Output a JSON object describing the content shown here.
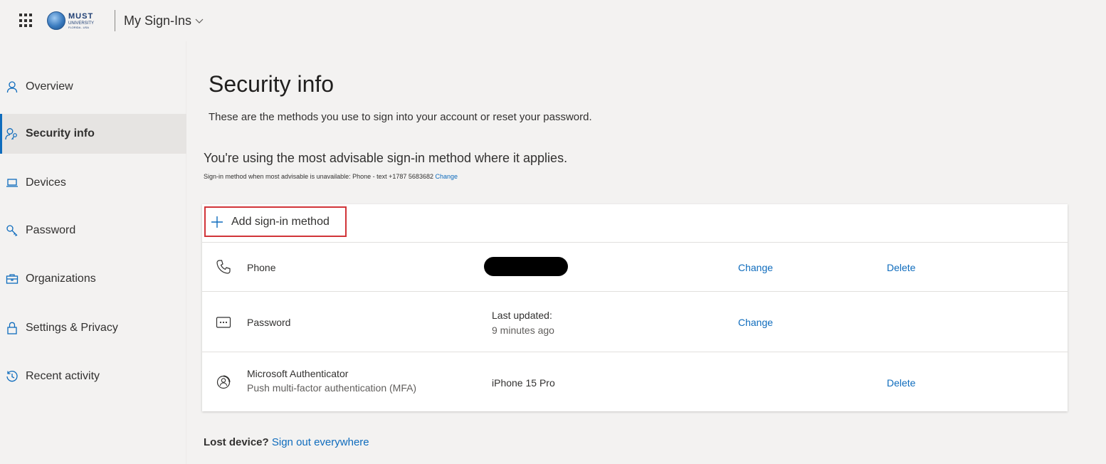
{
  "header": {
    "logo": {
      "line1": "MUST",
      "line2": "UNIVERSITY",
      "line3": "FLORIDA - USA"
    },
    "app_title": "My Sign-Ins"
  },
  "sidebar": {
    "items": [
      {
        "label": "Overview",
        "icon": "person-icon"
      },
      {
        "label": "Security info",
        "icon": "person-key-icon",
        "active": true
      },
      {
        "label": "Devices",
        "icon": "laptop-icon"
      },
      {
        "label": "Password",
        "icon": "key-icon"
      },
      {
        "label": "Organizations",
        "icon": "briefcase-icon"
      },
      {
        "label": "Settings & Privacy",
        "icon": "lock-icon"
      },
      {
        "label": "Recent activity",
        "icon": "history-icon"
      }
    ]
  },
  "main": {
    "title": "Security info",
    "subtitle": "These are the methods you use to sign into your account or reset your password.",
    "advisable": "You're using the most advisable sign-in method where it applies.",
    "fallback_text": "Sign-in method when most advisable is unavailable: Phone - text +1787 5683682",
    "fallback_link": "Change",
    "add_method_label": "Add sign-in method",
    "methods": [
      {
        "name": "Phone",
        "icon": "phone-icon",
        "detail": "",
        "redacted": true,
        "change": "Change",
        "delete": "Delete"
      },
      {
        "name": "Password",
        "icon": "password-dots-icon",
        "detail_line1": "Last updated:",
        "detail_line2": "9 minutes ago",
        "change": "Change"
      },
      {
        "name": "Microsoft Authenticator",
        "sub": "Push multi-factor authentication (MFA)",
        "icon": "authenticator-icon",
        "detail": "iPhone 15 Pro",
        "delete": "Delete"
      }
    ],
    "lost_device_label": "Lost device?",
    "sign_out_everywhere": "Sign out everywhere"
  },
  "colors": {
    "accent": "#0f6cbd",
    "highlight_border": "#d13438",
    "background": "#f3f2f1"
  }
}
